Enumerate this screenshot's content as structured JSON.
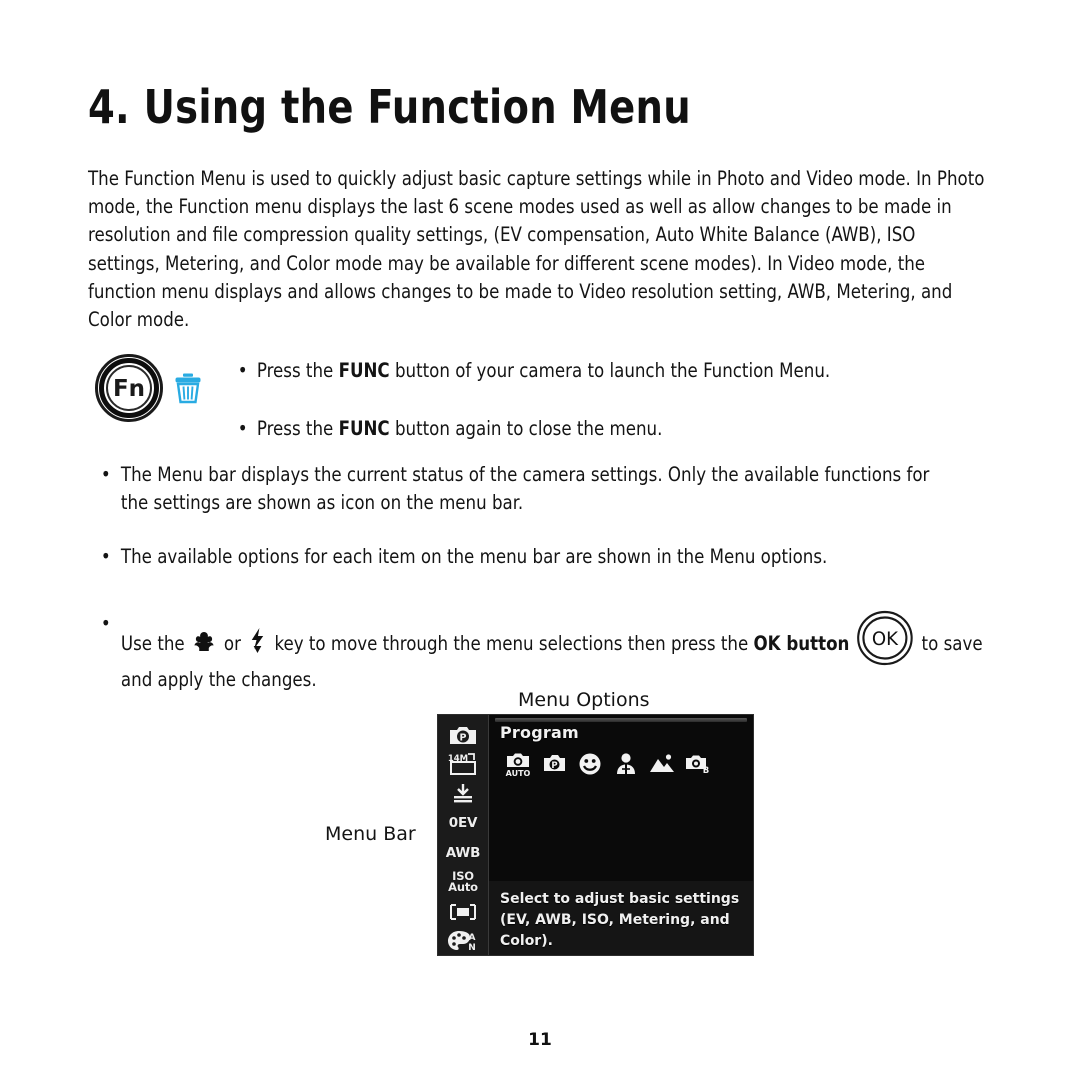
{
  "document": {
    "title": "4. Using the Function Menu",
    "page_number": "11",
    "intro": "The Function Menu is used to quickly adjust basic capture settings while in Photo and Video mode. In Photo mode, the Function menu displays the last 6 scene modes used as well as allow changes to be made in resolution and file compression quality settings, (EV compensation, Auto White Balance (AWB), ISO settings, Metering, and Color mode may be available for different scene modes). In Video mode, the function menu displays and allows changes to be made to Video resolution setting, AWB, Metering, and Color mode."
  },
  "fn_block": {
    "button_label": "Fn",
    "trash_icon": "trash-icon",
    "bullets": [
      {
        "pre": "Press the ",
        "bold": "FUNC",
        "post": " button of your camera to launch the Function Menu."
      },
      {
        "pre": "Press the ",
        "bold": "FUNC",
        "post": " button again to close the menu."
      }
    ]
  },
  "bullets": {
    "menu_bar": "The Menu bar displays the current status of the camera settings. Only the available functions for the settings are shown as icon on the menu bar.",
    "menu_options": "The available options for each item on the menu bar are shown in the Menu options.",
    "use_keys": {
      "part1": "Use the ",
      "macro_icon": "macro-flower-icon",
      "part2": " or ",
      "flash_icon": "flash-bolt-icon",
      "part3": " key to move through the menu selections then press the ",
      "bold": "OK button",
      "ok_label": "OK",
      "part4": " to save",
      "line2": "and apply the changes."
    }
  },
  "labels": {
    "menu_options": "Menu Options",
    "menu_bar": "Menu Bar"
  },
  "lcd": {
    "title": "Program",
    "description": "Select to adjust basic settings (EV, AWB, ISO, Metering, and Color).",
    "menu_bar_items": [
      {
        "name": "program-mode-icon",
        "type": "icon",
        "value": "P"
      },
      {
        "name": "resolution-icon",
        "type": "icon",
        "value": "14M"
      },
      {
        "name": "quality-icon",
        "type": "icon",
        "value": "fine"
      },
      {
        "name": "ev-compensation",
        "type": "text",
        "value": "0EV"
      },
      {
        "name": "white-balance",
        "type": "text",
        "value": "AWB"
      },
      {
        "name": "iso-setting",
        "type": "iso",
        "value": "ISO",
        "value2": "Auto"
      },
      {
        "name": "metering-icon",
        "type": "icon",
        "value": "multi"
      },
      {
        "name": "color-mode-icon",
        "type": "icon",
        "value": "N"
      }
    ],
    "scene_modes": [
      {
        "name": "scene-auto",
        "label": "AUTO"
      },
      {
        "name": "scene-program",
        "label": "P"
      },
      {
        "name": "scene-smile",
        "label": "smile"
      },
      {
        "name": "scene-portrait",
        "label": "portrait"
      },
      {
        "name": "scene-landscape",
        "label": "landscape"
      },
      {
        "name": "scene-panorama",
        "label": "panorama"
      }
    ]
  },
  "colors": {
    "trash_cyan": "#29abe2",
    "lcd_background": "#0a0a0a",
    "lcd_sidebar": "#1b1b1b",
    "lcd_desc_panel": "#151515",
    "text": "#141414"
  }
}
